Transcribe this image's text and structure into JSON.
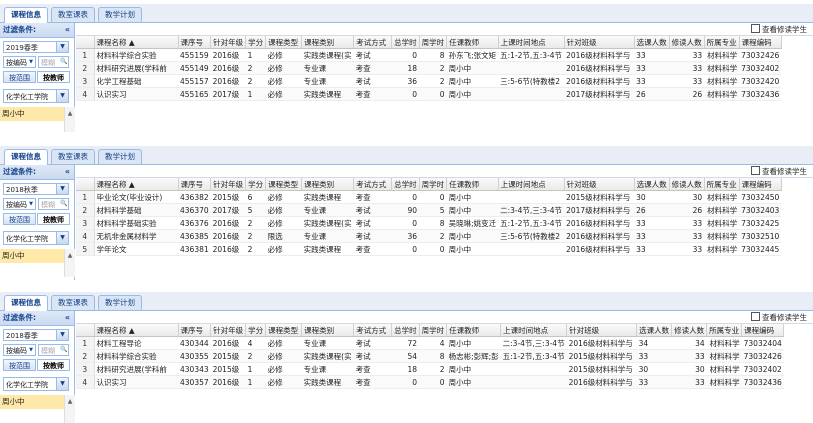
{
  "tabs": [
    "课程信息",
    "教室课表",
    "教学计划"
  ],
  "filter": {
    "title": "过滤条件:",
    "collapse": "«",
    "by_code": "按编码",
    "search_placeholder": "模糊",
    "by_scope": "按范围",
    "by_teacher": "按教师",
    "college": "化学化工学院",
    "teacher": "周小中"
  },
  "check_label": "查看修读学生",
  "columns": [
    "课程名称 ▲",
    "课序号",
    "针对年级",
    "学分",
    "课程类型",
    "课程类别",
    "考试方式",
    "总学时",
    "周学时",
    "任课教师",
    "上课时间地点",
    "针对班级",
    "选课人数",
    "修读人数",
    "所属专业",
    "课程编码"
  ],
  "panels": [
    {
      "term": "2019春季",
      "rows": [
        [
          "1",
          "材料科学综合实验",
          "455159",
          "2016级",
          "1",
          "必修",
          "实践类课程(实",
          "考试",
          "0",
          "8",
          "孙东飞;张文矩",
          "五:1-2节,五:3-4节",
          "2016级材料科学与",
          "33",
          "33",
          "材料科学",
          "73032426"
        ],
        [
          "2",
          "材料研究进展(学科前",
          "455149",
          "2016级",
          "2",
          "必修",
          "专业课",
          "考查",
          "18",
          "2",
          "周小中",
          "",
          "2016级材料科学与",
          "33",
          "33",
          "材料科学",
          "73032402"
        ],
        [
          "3",
          "化学工程基础",
          "455157",
          "2016级",
          "2",
          "必修",
          "专业课",
          "考试",
          "36",
          "2",
          "周小中",
          "三:5-6节(特教楼2",
          "2016级材料科学与",
          "33",
          "33",
          "材料科学",
          "73032420"
        ],
        [
          "4",
          "认识实习",
          "455165",
          "2017级",
          "1",
          "必修",
          "实践类课程",
          "考查",
          "0",
          "0",
          "周小中",
          "",
          "2017级材料科学与",
          "26",
          "26",
          "材料科学",
          "73032436"
        ]
      ]
    },
    {
      "term": "2018秋季",
      "rows": [
        [
          "1",
          "毕业论文(毕业设计)",
          "436382",
          "2015级",
          "6",
          "必修",
          "实践类课程",
          "考查",
          "0",
          "0",
          "周小中",
          "",
          "2015级材料科学与",
          "30",
          "30",
          "材料科学",
          "73032450"
        ],
        [
          "2",
          "材料科学基础",
          "436370",
          "2017级",
          "5",
          "必修",
          "专业课",
          "考试",
          "90",
          "5",
          "周小中",
          "二:3-4节,三:3-4节",
          "2017级材料科学与",
          "26",
          "26",
          "材料科学",
          "73032403"
        ],
        [
          "3",
          "材料科学基础实验",
          "436376",
          "2016级",
          "2",
          "必修",
          "实践类课程(实",
          "考试",
          "0",
          "8",
          "吴晓琳;姚变迁",
          "五:1-2节,五:3-4节",
          "2016级材料科学与",
          "33",
          "33",
          "材料科学",
          "73032425"
        ],
        [
          "4",
          "无机非金属材料学",
          "436385",
          "2016级",
          "2",
          "限选",
          "专业课",
          "考试",
          "36",
          "2",
          "周小中",
          "三:5-6节(特教楼2",
          "2016级材料科学与",
          "33",
          "33",
          "材料科学",
          "73032510"
        ],
        [
          "5",
          "学年论文",
          "436381",
          "2016级",
          "2",
          "必修",
          "实践类课程",
          "考查",
          "0",
          "0",
          "周小中",
          "",
          "2016级材料科学与",
          "33",
          "33",
          "材料科学",
          "73032445"
        ]
      ]
    },
    {
      "term": "2018春季",
      "rows": [
        [
          "1",
          "材料工程导论",
          "430344",
          "2016级",
          "4",
          "必修",
          "专业课",
          "考试",
          "72",
          "4",
          "周小中",
          "二:3-4节,三:3-4节",
          "2016级材料科学与",
          "34",
          "34",
          "材料科学",
          "73032404"
        ],
        [
          "2",
          "材料科学综合实验",
          "430355",
          "2015级",
          "2",
          "必修",
          "实践类课程(实",
          "考试",
          "54",
          "8",
          "杨志彬;彭辉;彭",
          "五:1-2节,五:3-4节",
          "2015级材料科学与",
          "33",
          "33",
          "材料科学",
          "73032426"
        ],
        [
          "3",
          "材料研究进展(学科前",
          "430343",
          "2015级",
          "1",
          "必修",
          "专业课",
          "考查",
          "18",
          "2",
          "周小中",
          "",
          "2015级材料科学与",
          "30",
          "30",
          "材料科学",
          "73032402"
        ],
        [
          "4",
          "认识实习",
          "430357",
          "2016级",
          "1",
          "必修",
          "实践类课程",
          "考查",
          "0",
          "0",
          "周小中",
          "",
          "2016级材料科学与",
          "33",
          "33",
          "材料科学",
          "73032436"
        ]
      ]
    }
  ]
}
